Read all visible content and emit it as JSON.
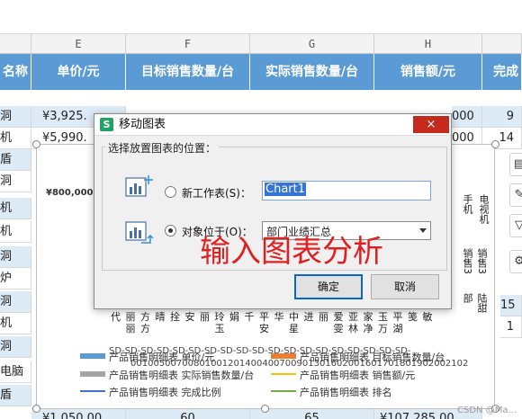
{
  "sheet": {
    "col_letters": [
      "E",
      "F",
      "G",
      "H"
    ],
    "headers": [
      "名称",
      "单价/元",
      "目标销售数量/台",
      "实际销售数量/台",
      "销售额/元",
      "完成"
    ],
    "row_first": [
      "洞",
      "机",
      "盾",
      "洞",
      "机",
      "机",
      "洞",
      "炉",
      "洞",
      "机",
      "洞",
      "电脑",
      "盾",
      ""
    ],
    "price_values": [
      "¥3,925.",
      "¥5,990.",
      "¥1,050.00"
    ],
    "sales_values": [
      "000",
      "000",
      "¥107,285.00"
    ],
    "bottom_values": [
      "60",
      "65"
    ],
    "last_col_values": [
      "9",
      "14",
      "15",
      "1"
    ]
  },
  "chart": {
    "y_tick": "¥800,000.0",
    "vertical_labels": [
      "电视机",
      "手机",
      "销售3",
      "销售3",
      "部",
      "陆甜"
    ],
    "x_names": [
      "代",
      "丽丽",
      "方方",
      "晴",
      "拴",
      "安",
      "丽",
      "玲玉",
      "娟",
      "千",
      "平安",
      "华",
      "中星",
      "进",
      "丽",
      "爱雯",
      "亚林",
      "家净",
      "玉万",
      "平湖",
      "笺",
      "敏"
    ],
    "x_codes": [
      "SD-SD-SD-SD-SD-SD-SD-SD-SD-SD-SD-SD-SD-SD-SD-SD-SD-SD-SD-",
      "00100500700801001201400400700901301602001601701801902002102"
    ],
    "legend": [
      {
        "name": "产品销售明细表 单价/元",
        "color": "#5b9bd5"
      },
      {
        "name": "产品销售明细表 目标销售数量/台",
        "color": "#ed7d31"
      },
      {
        "name": "产品销售明细表 实际销售数量/台",
        "color": "#a5a5a5"
      },
      {
        "name": "产品销售明细表 销售额/元",
        "color": "#ffc000"
      },
      {
        "name": "产品销售明细表 完成比例",
        "color": "#4472c4"
      },
      {
        "name": "产品销售明细表 排名",
        "color": "#70ad47"
      }
    ]
  },
  "dialog": {
    "title": "移动图表",
    "close_icon": "×",
    "group_label": "选择放置图表的位置：",
    "option_new_sheet": "新工作表(S)：",
    "new_sheet_value": "Chart1",
    "option_object_in": "对象位于(O)：",
    "object_in_value": "部门业绩汇总",
    "ok_label": "确定",
    "cancel_label": "取消",
    "selected_option": "object_in"
  },
  "overlay_text": "输入图表分析",
  "watermark": "CSDN @Ma..."
}
